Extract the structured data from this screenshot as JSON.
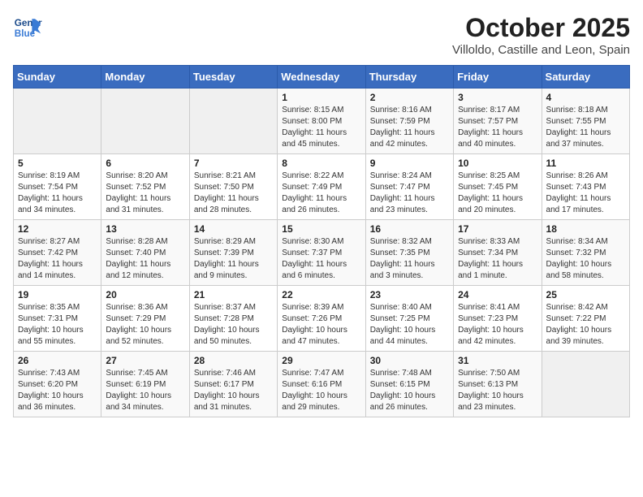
{
  "header": {
    "logo_line1": "General",
    "logo_line2": "Blue",
    "month": "October 2025",
    "location": "Villoldo, Castille and Leon, Spain"
  },
  "weekdays": [
    "Sunday",
    "Monday",
    "Tuesday",
    "Wednesday",
    "Thursday",
    "Friday",
    "Saturday"
  ],
  "weeks": [
    [
      {
        "day": "",
        "info": ""
      },
      {
        "day": "",
        "info": ""
      },
      {
        "day": "",
        "info": ""
      },
      {
        "day": "1",
        "info": "Sunrise: 8:15 AM\nSunset: 8:00 PM\nDaylight: 11 hours\nand 45 minutes."
      },
      {
        "day": "2",
        "info": "Sunrise: 8:16 AM\nSunset: 7:59 PM\nDaylight: 11 hours\nand 42 minutes."
      },
      {
        "day": "3",
        "info": "Sunrise: 8:17 AM\nSunset: 7:57 PM\nDaylight: 11 hours\nand 40 minutes."
      },
      {
        "day": "4",
        "info": "Sunrise: 8:18 AM\nSunset: 7:55 PM\nDaylight: 11 hours\nand 37 minutes."
      }
    ],
    [
      {
        "day": "5",
        "info": "Sunrise: 8:19 AM\nSunset: 7:54 PM\nDaylight: 11 hours\nand 34 minutes."
      },
      {
        "day": "6",
        "info": "Sunrise: 8:20 AM\nSunset: 7:52 PM\nDaylight: 11 hours\nand 31 minutes."
      },
      {
        "day": "7",
        "info": "Sunrise: 8:21 AM\nSunset: 7:50 PM\nDaylight: 11 hours\nand 28 minutes."
      },
      {
        "day": "8",
        "info": "Sunrise: 8:22 AM\nSunset: 7:49 PM\nDaylight: 11 hours\nand 26 minutes."
      },
      {
        "day": "9",
        "info": "Sunrise: 8:24 AM\nSunset: 7:47 PM\nDaylight: 11 hours\nand 23 minutes."
      },
      {
        "day": "10",
        "info": "Sunrise: 8:25 AM\nSunset: 7:45 PM\nDaylight: 11 hours\nand 20 minutes."
      },
      {
        "day": "11",
        "info": "Sunrise: 8:26 AM\nSunset: 7:43 PM\nDaylight: 11 hours\nand 17 minutes."
      }
    ],
    [
      {
        "day": "12",
        "info": "Sunrise: 8:27 AM\nSunset: 7:42 PM\nDaylight: 11 hours\nand 14 minutes."
      },
      {
        "day": "13",
        "info": "Sunrise: 8:28 AM\nSunset: 7:40 PM\nDaylight: 11 hours\nand 12 minutes."
      },
      {
        "day": "14",
        "info": "Sunrise: 8:29 AM\nSunset: 7:39 PM\nDaylight: 11 hours\nand 9 minutes."
      },
      {
        "day": "15",
        "info": "Sunrise: 8:30 AM\nSunset: 7:37 PM\nDaylight: 11 hours\nand 6 minutes."
      },
      {
        "day": "16",
        "info": "Sunrise: 8:32 AM\nSunset: 7:35 PM\nDaylight: 11 hours\nand 3 minutes."
      },
      {
        "day": "17",
        "info": "Sunrise: 8:33 AM\nSunset: 7:34 PM\nDaylight: 11 hours\nand 1 minute."
      },
      {
        "day": "18",
        "info": "Sunrise: 8:34 AM\nSunset: 7:32 PM\nDaylight: 10 hours\nand 58 minutes."
      }
    ],
    [
      {
        "day": "19",
        "info": "Sunrise: 8:35 AM\nSunset: 7:31 PM\nDaylight: 10 hours\nand 55 minutes."
      },
      {
        "day": "20",
        "info": "Sunrise: 8:36 AM\nSunset: 7:29 PM\nDaylight: 10 hours\nand 52 minutes."
      },
      {
        "day": "21",
        "info": "Sunrise: 8:37 AM\nSunset: 7:28 PM\nDaylight: 10 hours\nand 50 minutes."
      },
      {
        "day": "22",
        "info": "Sunrise: 8:39 AM\nSunset: 7:26 PM\nDaylight: 10 hours\nand 47 minutes."
      },
      {
        "day": "23",
        "info": "Sunrise: 8:40 AM\nSunset: 7:25 PM\nDaylight: 10 hours\nand 44 minutes."
      },
      {
        "day": "24",
        "info": "Sunrise: 8:41 AM\nSunset: 7:23 PM\nDaylight: 10 hours\nand 42 minutes."
      },
      {
        "day": "25",
        "info": "Sunrise: 8:42 AM\nSunset: 7:22 PM\nDaylight: 10 hours\nand 39 minutes."
      }
    ],
    [
      {
        "day": "26",
        "info": "Sunrise: 7:43 AM\nSunset: 6:20 PM\nDaylight: 10 hours\nand 36 minutes."
      },
      {
        "day": "27",
        "info": "Sunrise: 7:45 AM\nSunset: 6:19 PM\nDaylight: 10 hours\nand 34 minutes."
      },
      {
        "day": "28",
        "info": "Sunrise: 7:46 AM\nSunset: 6:17 PM\nDaylight: 10 hours\nand 31 minutes."
      },
      {
        "day": "29",
        "info": "Sunrise: 7:47 AM\nSunset: 6:16 PM\nDaylight: 10 hours\nand 29 minutes."
      },
      {
        "day": "30",
        "info": "Sunrise: 7:48 AM\nSunset: 6:15 PM\nDaylight: 10 hours\nand 26 minutes."
      },
      {
        "day": "31",
        "info": "Sunrise: 7:50 AM\nSunset: 6:13 PM\nDaylight: 10 hours\nand 23 minutes."
      },
      {
        "day": "",
        "info": ""
      }
    ]
  ]
}
